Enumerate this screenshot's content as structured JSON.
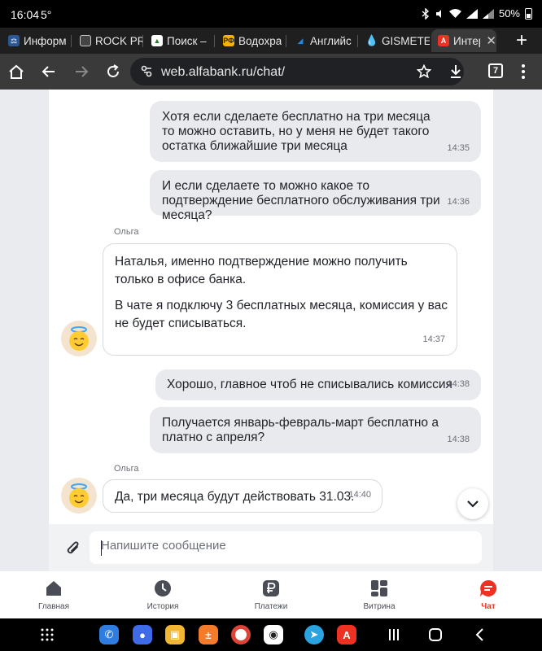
{
  "status_bar": {
    "time": "16:04",
    "temperature": "5°",
    "battery": "50%"
  },
  "tabs": [
    {
      "label": "Информ",
      "favicon": "scales-icon",
      "color": "#2b5797"
    },
    {
      "label": "ROCK PR",
      "favicon": "document-icon",
      "color": "#444444"
    },
    {
      "label": "Поиск –",
      "favicon": "triangle-icon",
      "color": "#2e7d32"
    },
    {
      "label": "Водохра",
      "favicon": "rf-icon",
      "color": "#f4b400"
    },
    {
      "label": "Английс",
      "favicon": "bird-icon",
      "color": "#1565c0"
    },
    {
      "label": "GISMETE",
      "favicon": "drop-icon",
      "color": "#29b6f6"
    },
    {
      "label": "Интер",
      "favicon": "alfa-icon",
      "color": "#ef3124"
    }
  ],
  "address_bar": {
    "url": "web.alfabank.ru/chat/",
    "tab_count": "7"
  },
  "chat": {
    "messages": [
      {
        "dir": "out",
        "text": "Хотя если сделаете бесплатно на три месяца то можно оставить, но у меня не будет такого остатка ближайшие три месяца",
        "time": "14:35"
      },
      {
        "dir": "out",
        "text": "И если сделаете то можно какое то подтверждение бесплатного обслуживания три месяца?",
        "time": "14:36"
      },
      {
        "dir": "in",
        "sender": "Ольга",
        "paragraphs": [
          "Наталья, именно подтверждение можно получить только в офисе банка.",
          "В чате я подключу 3 бесплатных месяца, комиссия у вас не будет списываться."
        ],
        "time": "14:37"
      },
      {
        "dir": "out",
        "text": "Хорошо, главное чтоб не списывались комиссия",
        "time": "14:38"
      },
      {
        "dir": "out",
        "text": "Получается январь-февраль-март бесплатно а платно с апреля?",
        "time": "14:38"
      },
      {
        "dir": "in",
        "sender": "Ольга",
        "text": "Да, три месяца будут действовать 31.03.",
        "time": "14:40"
      }
    ],
    "composer_placeholder": "Напишите сообщение"
  },
  "bottom_nav": [
    {
      "label": "Главная",
      "icon": "home-icon"
    },
    {
      "label": "История",
      "icon": "clock-icon"
    },
    {
      "label": "Платежи",
      "icon": "ruble-icon"
    },
    {
      "label": "Витрина",
      "icon": "grid-icon"
    },
    {
      "label": "Чат",
      "icon": "chat-icon",
      "active": true
    }
  ],
  "colors": {
    "accent": "#ef3124",
    "bubble_out": "#e9eaee",
    "page_bg": "#e9ebef"
  }
}
